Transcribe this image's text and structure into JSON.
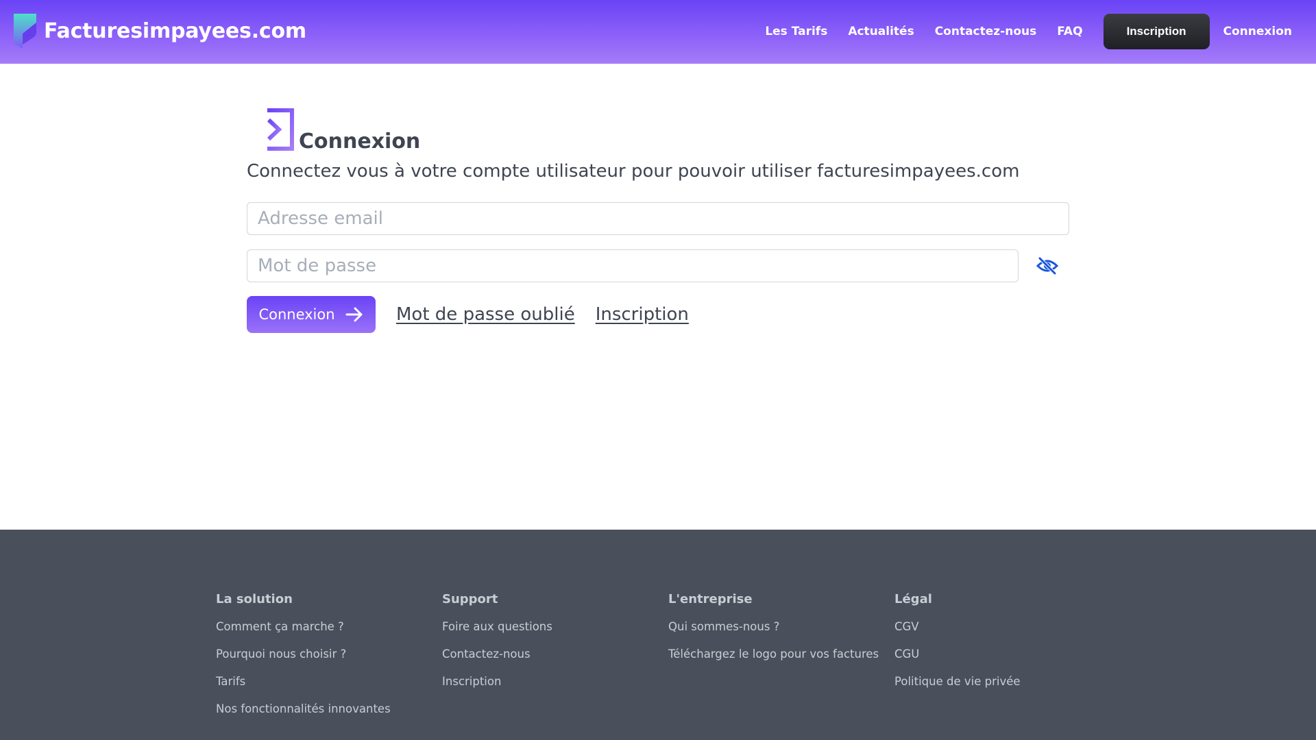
{
  "header": {
    "brand_name": "Facturesimpayees.com",
    "nav": {
      "tarifs": "Les Tarifs",
      "actualites": "Actualités",
      "contact": "Contactez-nous",
      "faq": "FAQ",
      "inscription": "Inscription",
      "connexion": "Connexion"
    }
  },
  "main": {
    "title": "Connexion",
    "subtitle": "Connectez vous à votre compte utilisateur pour pouvoir utiliser facturesimpayees.com",
    "email_placeholder": "Adresse email",
    "password_placeholder": "Mot de passe",
    "login_button": "Connexion",
    "forgot_link": "Mot de passe oublié",
    "signup_link": "Inscription",
    "icons": {
      "title": "login-icon",
      "password_toggle": "eye-off-icon",
      "button": "arrow-right-icon"
    }
  },
  "footer": {
    "columns": [
      {
        "heading": "La solution",
        "links": [
          "Comment ça marche ?",
          "Pourquoi nous choisir ?",
          "Tarifs",
          "Nos fonctionnalités innovantes"
        ]
      },
      {
        "heading": "Support",
        "links": [
          "Foire aux questions",
          "Contactez-nous",
          "Inscription"
        ]
      },
      {
        "heading": "L'entreprise",
        "links": [
          "Qui sommes-nous ?",
          "Téléchargez le logo pour vos factures"
        ]
      },
      {
        "heading": "Légal",
        "links": [
          "CGV",
          "CGU",
          "Politique de vie privée"
        ]
      }
    ]
  },
  "colors": {
    "brand_purple": "#6a43f6",
    "brand_purple_light": "#a57cf9",
    "dark_button": "#2a2b30",
    "footer_bg": "#4a505b",
    "eye_icon_blue": "#1a56db"
  }
}
